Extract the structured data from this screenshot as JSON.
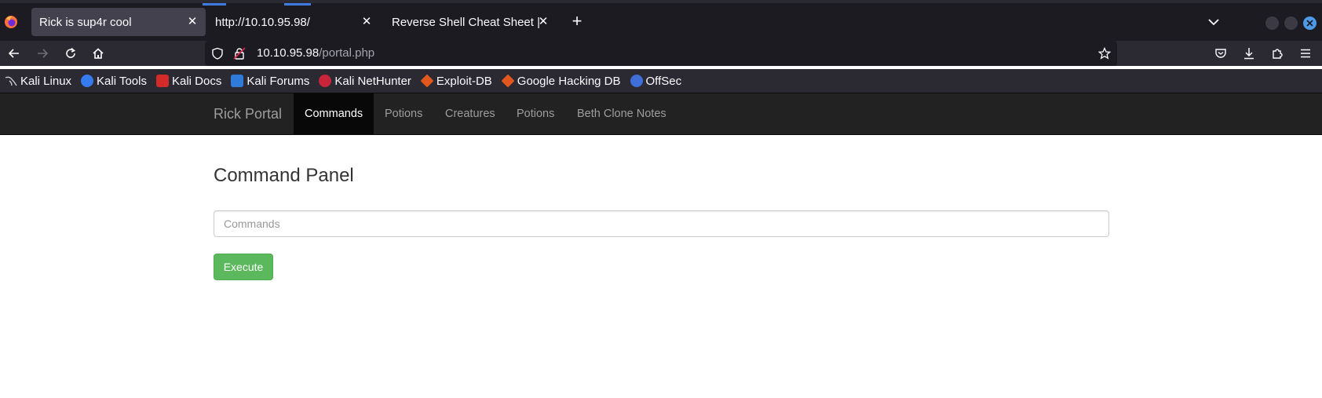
{
  "browser": {
    "tabs": [
      {
        "title": "Rick is sup4r cool",
        "active": true
      },
      {
        "title": "http://10.10.95.98/",
        "active": false
      },
      {
        "title": "Reverse Shell Cheat Sheet | p",
        "active": false
      }
    ],
    "url": {
      "host": "10.10.95.98",
      "path": "/portal.php"
    },
    "bookmarks": [
      {
        "label": "Kali Linux",
        "icon": "kali-dragon-icon"
      },
      {
        "label": "Kali Tools",
        "icon": "kali-tools-icon"
      },
      {
        "label": "Kali Docs",
        "icon": "kali-docs-icon"
      },
      {
        "label": "Kali Forums",
        "icon": "kali-forums-icon"
      },
      {
        "label": "Kali NetHunter",
        "icon": "nethunter-icon"
      },
      {
        "label": "Exploit-DB",
        "icon": "exploit-db-icon"
      },
      {
        "label": "Google Hacking DB",
        "icon": "ghdb-icon"
      },
      {
        "label": "OffSec",
        "icon": "offsec-icon"
      }
    ]
  },
  "site": {
    "brand": "Rick Portal",
    "nav": [
      {
        "label": "Commands",
        "active": true
      },
      {
        "label": "Potions",
        "active": false
      },
      {
        "label": "Creatures",
        "active": false
      },
      {
        "label": "Potions",
        "active": false
      },
      {
        "label": "Beth Clone Notes",
        "active": false
      }
    ]
  },
  "main": {
    "title": "Command Panel",
    "input_placeholder": "Commands",
    "input_value": "",
    "execute_label": "Execute"
  },
  "colors": {
    "navbar_bg": "#222222",
    "active_nav_bg": "#080808",
    "execute_button": "#5cb85c",
    "browser_chrome": "#1c1b22"
  }
}
